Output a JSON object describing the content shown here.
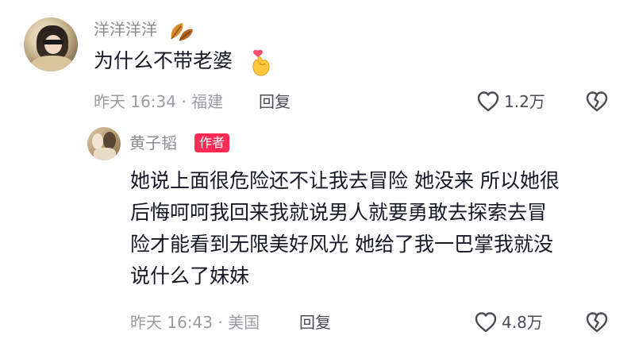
{
  "comment": {
    "username": "洋洋洋洋",
    "username_emoji_icon": "fallen-leaf-icon",
    "text": "为什么不带老婆",
    "text_emoji_icon": "finger-heart-icon",
    "time_location": "昨天 16:34 · 福建",
    "reply_label": "回复",
    "like_count": "1.2万"
  },
  "reply": {
    "username": "黄子韬",
    "badge": "作者",
    "lines": [
      "她说上面很危险还不让我去冒险 她没来 所以她很",
      "后悔呵呵我回来我就说男人就要勇敢去探索去冒",
      "险才能看到无限美好风光 她给了我一巴掌我就没",
      "说什么了妹妹"
    ],
    "time_location": "昨天 16:43 · 美国",
    "reply_label": "回复",
    "like_count": "4.8万"
  },
  "colors": {
    "badge_bg": "#fe2c55",
    "username": "#8a8b91",
    "text": "#161823",
    "meta": "#9a9ba1"
  }
}
